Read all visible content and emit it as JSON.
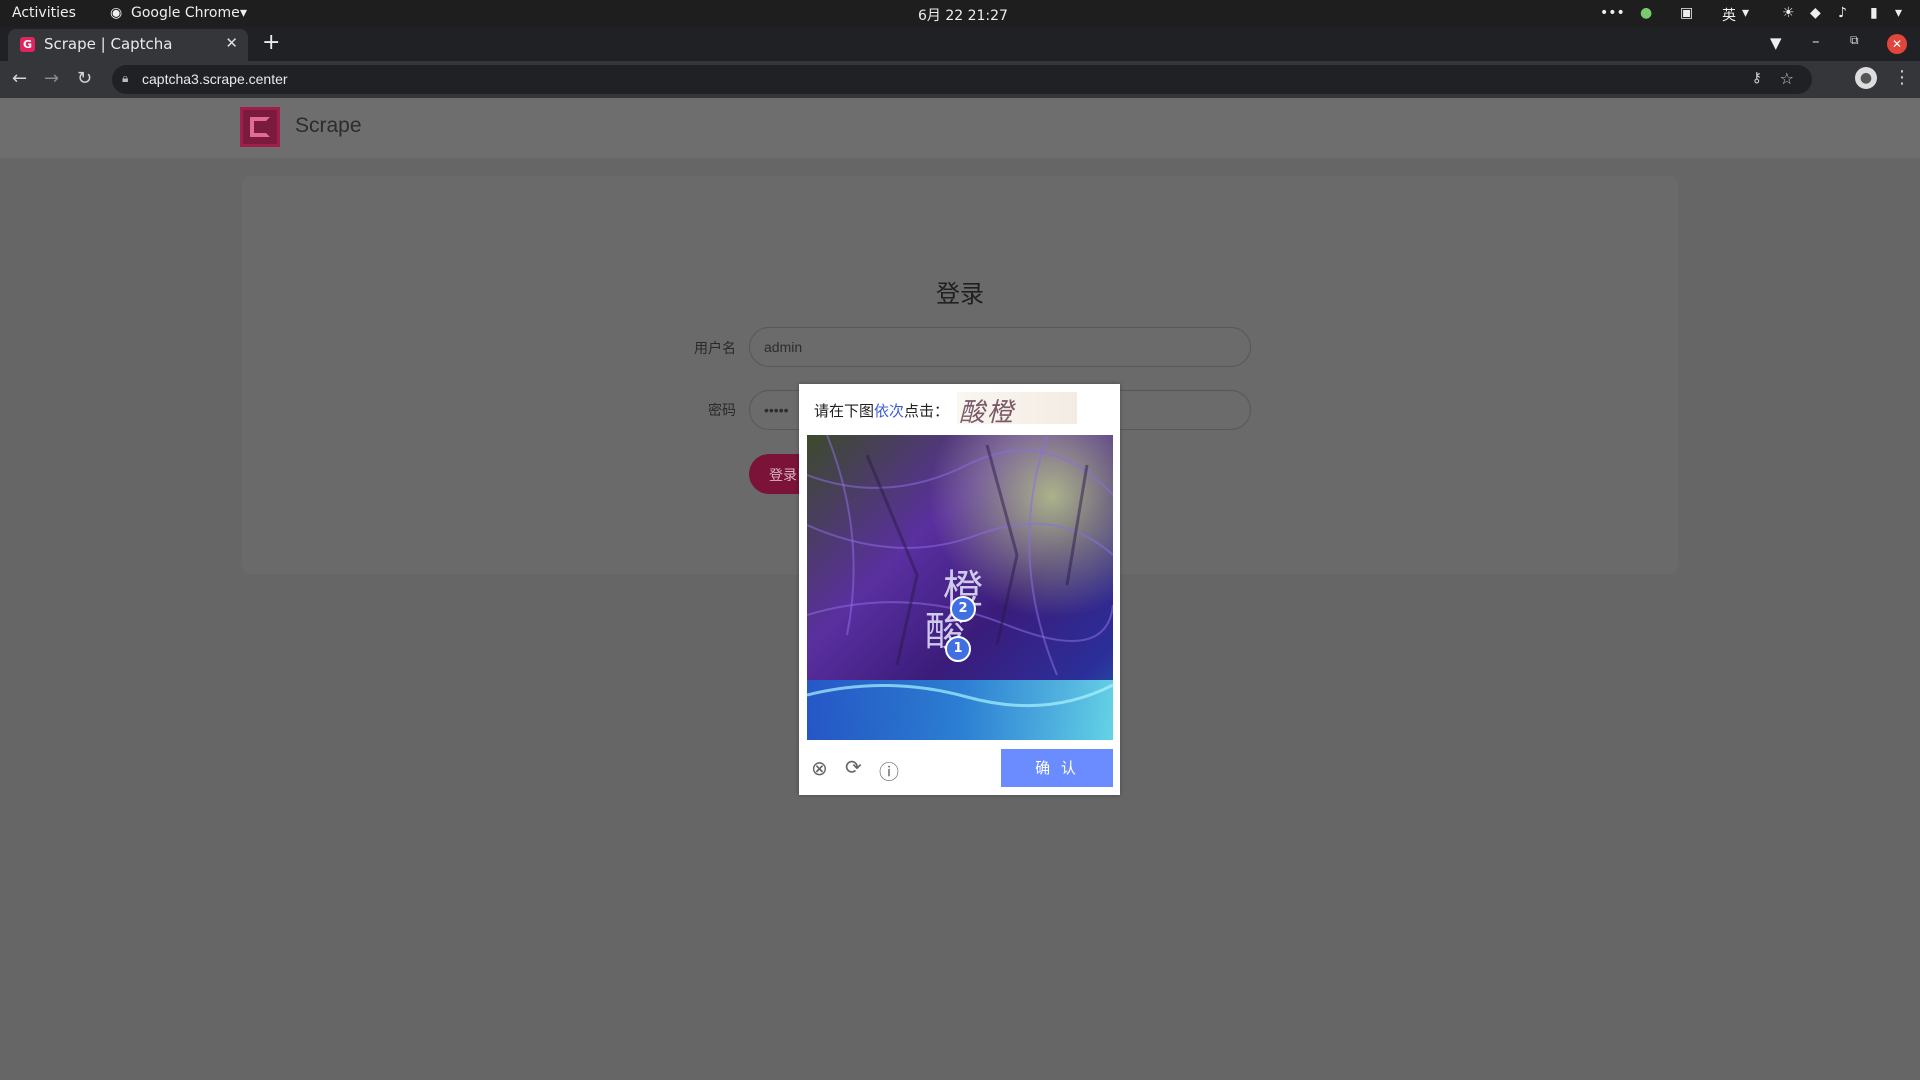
{
  "system_bar": {
    "activities": "Activities",
    "app_menu": "Google Chrome",
    "clock": "6月 22  21:27",
    "input_method": "英"
  },
  "browser": {
    "tab_title": "Scrape | Captcha",
    "favicon_letter": "G",
    "url": "captcha3.scrape.center"
  },
  "site": {
    "brand": "Scrape"
  },
  "login": {
    "title": "登录",
    "username_label": "用户名",
    "username_value": "admin",
    "password_label": "密码",
    "password_value": "•••••",
    "submit_label": "登录"
  },
  "captcha": {
    "prompt_prefix": "请在下图",
    "prompt_highlight": "依次",
    "prompt_suffix": "点击：",
    "target_chars": "酸橙",
    "image_char_top": "橙",
    "image_char_bottom": "酸",
    "marker_1": "1",
    "marker_2": "2",
    "confirm_label": "确 认"
  }
}
